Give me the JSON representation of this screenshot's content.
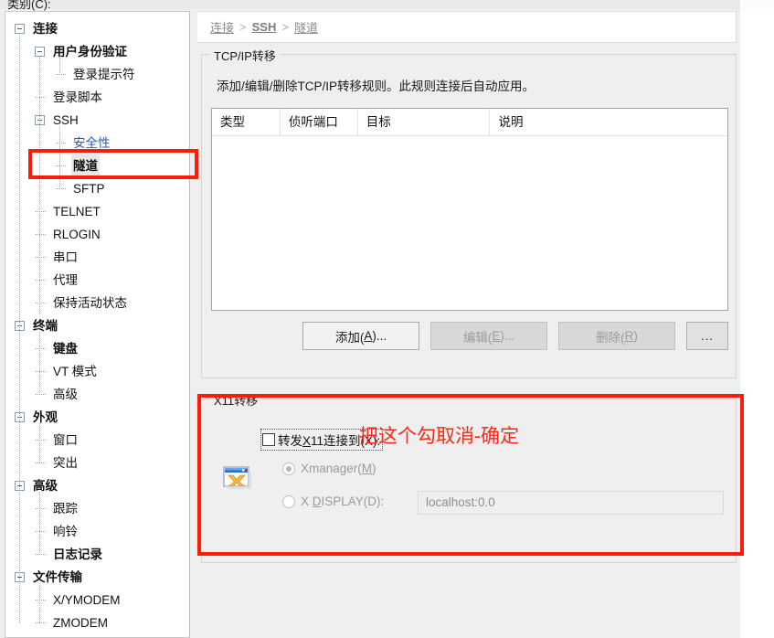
{
  "dialog": {
    "category_label": "类别(C):"
  },
  "tree": {
    "items": [
      {
        "label": "连接",
        "depth": 0,
        "expander": true,
        "bold": true,
        "selected": false,
        "link": false
      },
      {
        "label": "用户身份验证",
        "depth": 1,
        "expander": true,
        "bold": true,
        "selected": false,
        "link": false
      },
      {
        "label": "登录提示符",
        "depth": 2,
        "expander": false,
        "bold": false,
        "selected": false,
        "link": false
      },
      {
        "label": "登录脚本",
        "depth": 1,
        "expander": false,
        "bold": false,
        "selected": false,
        "link": false
      },
      {
        "label": "SSH",
        "depth": 1,
        "expander": true,
        "bold": false,
        "selected": false,
        "link": false
      },
      {
        "label": "安全性",
        "depth": 2,
        "expander": false,
        "bold": false,
        "selected": false,
        "link": true
      },
      {
        "label": "隧道",
        "depth": 2,
        "expander": false,
        "bold": true,
        "selected": true,
        "link": false
      },
      {
        "label": "SFTP",
        "depth": 2,
        "expander": false,
        "bold": false,
        "selected": false,
        "link": false
      },
      {
        "label": "TELNET",
        "depth": 1,
        "expander": false,
        "bold": false,
        "selected": false,
        "link": false
      },
      {
        "label": "RLOGIN",
        "depth": 1,
        "expander": false,
        "bold": false,
        "selected": false,
        "link": false
      },
      {
        "label": "串口",
        "depth": 1,
        "expander": false,
        "bold": false,
        "selected": false,
        "link": false
      },
      {
        "label": "代理",
        "depth": 1,
        "expander": false,
        "bold": false,
        "selected": false,
        "link": false
      },
      {
        "label": "保持活动状态",
        "depth": 1,
        "expander": false,
        "bold": false,
        "selected": false,
        "link": false
      },
      {
        "label": "终端",
        "depth": 0,
        "expander": true,
        "bold": true,
        "selected": false,
        "link": false
      },
      {
        "label": "键盘",
        "depth": 1,
        "expander": false,
        "bold": true,
        "selected": false,
        "link": false
      },
      {
        "label": "VT 模式",
        "depth": 1,
        "expander": false,
        "bold": false,
        "selected": false,
        "link": false
      },
      {
        "label": "高级",
        "depth": 1,
        "expander": false,
        "bold": false,
        "selected": false,
        "link": false
      },
      {
        "label": "外观",
        "depth": 0,
        "expander": true,
        "bold": true,
        "selected": false,
        "link": false
      },
      {
        "label": "窗口",
        "depth": 1,
        "expander": false,
        "bold": false,
        "selected": false,
        "link": false
      },
      {
        "label": "突出",
        "depth": 1,
        "expander": false,
        "bold": false,
        "selected": false,
        "link": false
      },
      {
        "label": "高级",
        "depth": 0,
        "expander": true,
        "bold": true,
        "selected": false,
        "link": false
      },
      {
        "label": "跟踪",
        "depth": 1,
        "expander": false,
        "bold": false,
        "selected": false,
        "link": false
      },
      {
        "label": "响铃",
        "depth": 1,
        "expander": false,
        "bold": false,
        "selected": false,
        "link": false
      },
      {
        "label": "日志记录",
        "depth": 1,
        "expander": false,
        "bold": true,
        "selected": false,
        "link": false
      },
      {
        "label": "文件传输",
        "depth": 0,
        "expander": true,
        "bold": true,
        "selected": false,
        "link": false
      },
      {
        "label": "X/YMODEM",
        "depth": 1,
        "expander": false,
        "bold": false,
        "selected": false,
        "link": false
      },
      {
        "label": "ZMODEM",
        "depth": 1,
        "expander": false,
        "bold": false,
        "selected": false,
        "link": false
      }
    ]
  },
  "breadcrumb": {
    "item1": "连接",
    "sep1": ">",
    "item2": "SSH",
    "sep2": ">",
    "item3": "隧道"
  },
  "tcpip": {
    "legend": "TCP/IP转移",
    "description": "添加/编辑/删除TCP/IP转移规则。此规则连接后自动应用。",
    "columns": [
      "类型",
      "侦听端口",
      "目标",
      "说明"
    ],
    "rows": [],
    "buttons": {
      "add": "添加(A)...",
      "add_mnemonic": "A",
      "edit": "编辑(E)...",
      "edit_mnemonic": "E",
      "delete": "删除(R)",
      "delete_mnemonic": "R",
      "more": "..."
    }
  },
  "x11": {
    "legend": "X11转移",
    "forward_checkbox_label": "转发X11连接到(X):",
    "forward_checked": false,
    "radio_xmanager": "Xmanager(M)",
    "radio_xdisplay": "X DISPLAY(D):",
    "selected_radio": "xmanager",
    "xdisplay_value": "localhost:0.0"
  },
  "annotation": {
    "text": "把这个勾取消-确定",
    "color": "#fa2a14"
  }
}
